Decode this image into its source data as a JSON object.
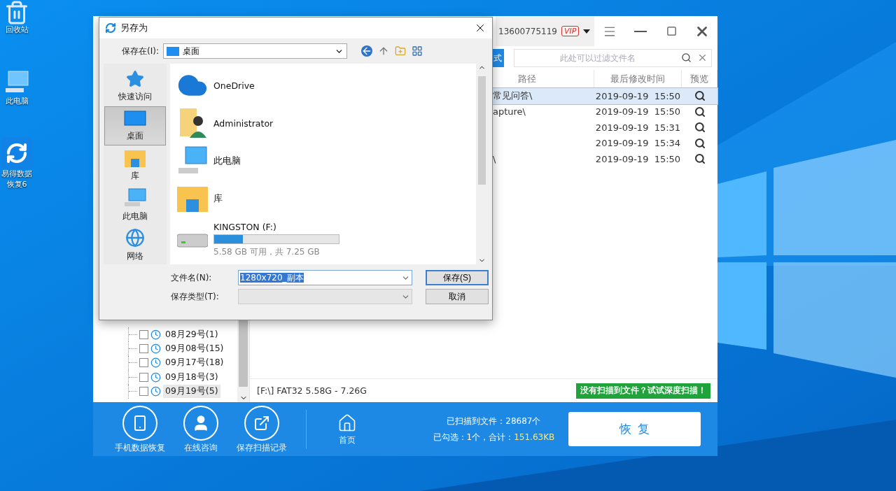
{
  "desktop_icons": [
    {
      "label": "回收站",
      "kind": "recycle"
    },
    {
      "label": "此电脑",
      "kind": "computer"
    },
    {
      "label": "易得数据恢复6",
      "kind": "app"
    }
  ],
  "app": {
    "account": "13600775119",
    "vip": "VIP",
    "toolbar_button": "式",
    "filter": {
      "placeholder": "此处可以过滤文件名"
    },
    "table": {
      "columns": [
        "路径",
        "最后修改时间",
        "预览"
      ],
      "rows": [
        {
          "path": "常见问答\\",
          "modified": "2019-09-19  15:50",
          "selected": true
        },
        {
          "path": "apture\\",
          "modified": "2019-09-19  15:50",
          "selected": false
        },
        {
          "modified": "2019-09-19  15:31",
          "selected": false
        },
        {
          "modified": "2019-09-19  15:34",
          "selected": false
        },
        {
          "path": "\\",
          "modified": "2019-09-19  15:50",
          "selected": false
        }
      ]
    },
    "tree": [
      {
        "label": "08月29号(1)",
        "checked": false,
        "selected": false
      },
      {
        "label": "09月08号(15)",
        "checked": false,
        "selected": false
      },
      {
        "label": "09月17号(18)",
        "checked": false,
        "selected": false
      },
      {
        "label": "09月18号(3)",
        "checked": false,
        "selected": false
      },
      {
        "label": "09月19号(5)",
        "checked": false,
        "selected": true
      }
    ],
    "status": "[F:\\] FAT32 5.58G - 7.26G",
    "deep_scan": "没有扫描到文件？试试深度扫描！",
    "actions": [
      {
        "label": "手机数据恢复",
        "kind": "phone"
      },
      {
        "label": "在线咨询",
        "kind": "person"
      },
      {
        "label": "保存扫描记录",
        "kind": "export"
      }
    ],
    "home": "首页",
    "scanned": "已扫描到文件：28687个",
    "checked_summary": "已勾选：1个，合计：",
    "checked_size": "151.63KB",
    "recover": "恢  复"
  },
  "dialog": {
    "title": "另存为",
    "save_in_label": "保存在(I):",
    "save_in": "桌面",
    "places": [
      {
        "label": "快速访问",
        "kind": "star",
        "selected": false
      },
      {
        "label": "桌面",
        "kind": "desktop",
        "selected": true
      },
      {
        "label": "库",
        "kind": "library",
        "selected": false
      },
      {
        "label": "此电脑",
        "kind": "computer",
        "selected": false
      },
      {
        "label": "网络",
        "kind": "network",
        "selected": false
      }
    ],
    "items": [
      {
        "label": "OneDrive",
        "kind": "cloud"
      },
      {
        "label": "Administrator",
        "kind": "user"
      },
      {
        "label": "此电脑",
        "kind": "computer"
      },
      {
        "label": "库",
        "kind": "library"
      },
      {
        "label": "KINGSTON (F:)",
        "kind": "drive",
        "level": 0.23,
        "detail": "5.58 GB 可用，共 7.25 GB"
      }
    ],
    "filename_label": "文件名(N):",
    "filename": "1280x720_副本",
    "save": "保存(S)",
    "type_label": "保存类型(T):",
    "cancel": "取消"
  }
}
